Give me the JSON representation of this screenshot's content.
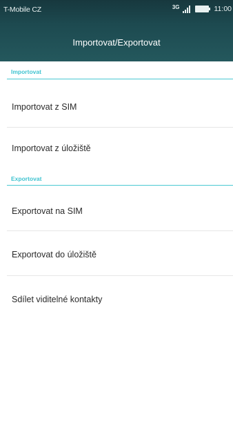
{
  "status_bar": {
    "carrier": "T-Mobile CZ",
    "network_type": "3G",
    "signal_icon": "signal-icon",
    "battery_icon": "battery-icon",
    "time": "11:00"
  },
  "header": {
    "title": "Importovat/Exportovat"
  },
  "sections": {
    "import": {
      "label": "Importovat",
      "items": [
        {
          "label": "Importovat z SIM"
        },
        {
          "label": "Importovat z úložiště"
        }
      ]
    },
    "export": {
      "label": "Exportovat",
      "items": [
        {
          "label": "Exportovat na SIM"
        },
        {
          "label": "Exportovat do úložiště"
        },
        {
          "label": "Sdílet viditelné kontakty"
        }
      ]
    }
  },
  "colors": {
    "header_background": "#1d4a50",
    "accent": "#3fc3d0",
    "text": "#2a2a2a"
  }
}
